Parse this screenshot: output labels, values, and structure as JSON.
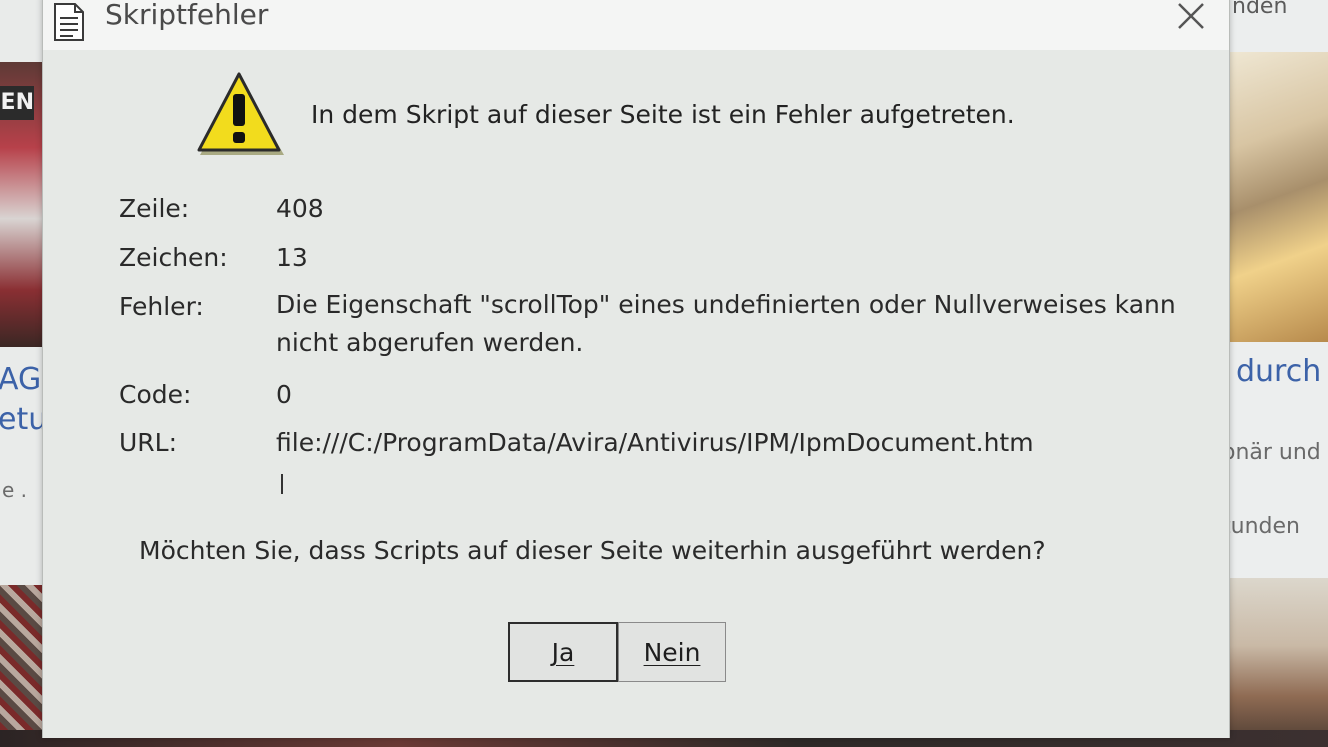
{
  "background": {
    "left_badge": "EN",
    "left_link_1": "AGI",
    "left_link_2": "etu",
    "left_dots": "e .",
    "right_top": "nden",
    "right_link": "durch",
    "right_text_1": "onär und",
    "right_text_2": "tunden"
  },
  "dialog": {
    "title": "Skriptfehler",
    "title_icon": "document-icon",
    "close_icon": "close-icon",
    "warning_icon": "warning-icon",
    "headline": "In dem Skript auf dieser Seite ist ein Fehler aufgetreten.",
    "details": {
      "line_label": "Zeile:",
      "line_value": "408",
      "char_label": "Zeichen:",
      "char_value": "13",
      "error_label": "Fehler:",
      "error_value": "Die Eigenschaft \"scrollTop\" eines undefinierten oder Nullverweises kann nicht abgerufen werden.",
      "code_label": "Code:",
      "code_value": "0",
      "url_label": "URL:",
      "url_value": "file:///C:/ProgramData/Avira/Antivirus/IPM/IpmDocument.htm"
    },
    "question": "Möchten Sie, dass Scripts auf dieser Seite weiterhin ausgeführt werden?",
    "buttons": {
      "yes": "Ja",
      "no": "Nein"
    }
  },
  "colors": {
    "dialog_bg": "#e6e9e6",
    "warning_yellow": "#f2dc1d",
    "link_blue": "#3c62a8"
  }
}
